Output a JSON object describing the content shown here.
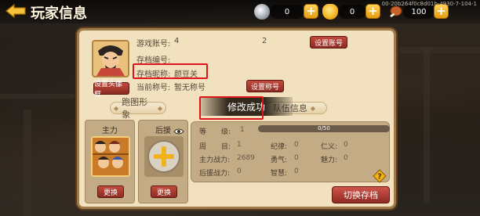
{
  "header": {
    "title": "玩家信息",
    "build_id": "00-20b264f0c8d01b-4930-7-104-1"
  },
  "resources": [
    {
      "icon": "silver-coin-icon",
      "value": "0"
    },
    {
      "icon": "gold-ingot-icon",
      "value": "0"
    },
    {
      "icon": "drumstick-icon",
      "value": "100"
    }
  ],
  "profile": {
    "set_avatar_label": "设置头像框",
    "account_label": "游戏账号:",
    "account_value": "4",
    "account_trailing": "2",
    "set_account_label": "设置账号",
    "save_id_label": "存档编号:",
    "save_id_value": "",
    "save_name_label": "存档昵称:",
    "save_name_value": "颜豆关",
    "title_label": "当前称号:",
    "title_value": "暂无称号",
    "set_title_label": "设置称号"
  },
  "tabs": {
    "run_image": "跑图形象",
    "team_info": "队伍信息"
  },
  "toast": "修改成功",
  "slots": {
    "main_label": "主力",
    "backup_label": "后援",
    "main_change": "更换",
    "backup_change": "更换"
  },
  "stats": {
    "level_label": "等",
    "level_label2": "级:",
    "level_value": "1",
    "xp_text": "0/50",
    "xp_fraction": 0.0,
    "week_label": "周",
    "week_label2": "目:",
    "week_value": "1",
    "discipline_label": "纪律:",
    "discipline_value": "0",
    "benevolence_label": "仁义:",
    "benevolence_value": "0",
    "main_power_label": "主力战力:",
    "main_power_value": "2689",
    "courage_label": "勇气:",
    "courage_value": "0",
    "charm_label": "魅力:",
    "charm_value": "0",
    "backup_power_label": "后援战力:",
    "backup_power_value": "0",
    "wisdom_label": "智慧:",
    "wisdom_value": "0"
  },
  "switch_save": "切换存档",
  "colors": {
    "accent_red": "#e0141b",
    "panel_bg": "#f1e1be",
    "button_red": "#b23b30",
    "gold": "#f2b21c"
  }
}
